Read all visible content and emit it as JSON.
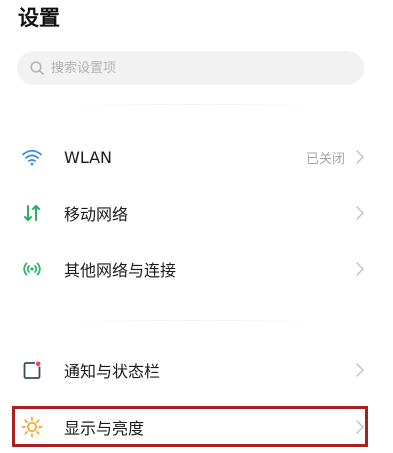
{
  "header": {
    "title": "设置"
  },
  "search": {
    "placeholder": "搜索设置项"
  },
  "settings": {
    "wlan": {
      "label": "WLAN",
      "value": "已关闭",
      "icon": "wifi-icon"
    },
    "mobile_network": {
      "label": "移动网络",
      "icon": "mobile-data-icon"
    },
    "other_networks": {
      "label": "其他网络与连接",
      "icon": "connection-icon"
    },
    "notifications": {
      "label": "通知与状态栏",
      "icon": "notification-icon"
    },
    "display": {
      "label": "显示与亮度",
      "icon": "sun-icon"
    }
  },
  "colors": {
    "wifi_blue": "#3f8ddf",
    "mobile_green": "#27b35c",
    "connection_green": "#2db36a",
    "notification_red": "#e84a4a",
    "sun_orange": "#f5a623",
    "highlight_red": "#a8211f"
  }
}
